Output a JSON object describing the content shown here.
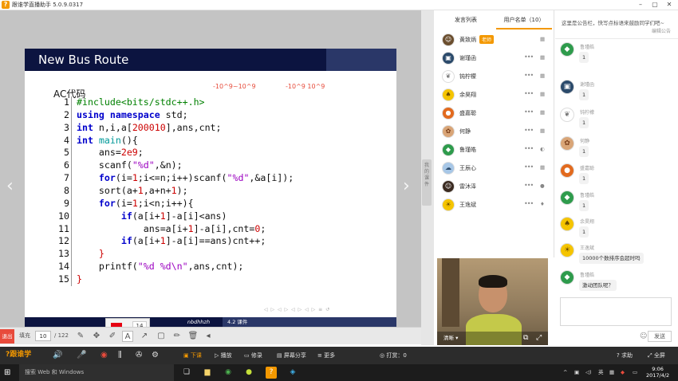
{
  "window": {
    "title": "跟谁学直播助手 5.0.9.0317",
    "logo": "?",
    "min": "–",
    "max": "▢",
    "close": "✕"
  },
  "slide": {
    "title": "New Bus Route",
    "ac_label": "AC代码",
    "note_left": "-10^9~10^9",
    "note_right": "-10^9 10^9",
    "footer_mid": "nbdhhzh",
    "footer_right": "4.2 课件",
    "beamer_nav": "◁ ▷ ◁ ▷ ◁ ▷ ◁ ▷ ≡ ↺"
  },
  "code_lines": [
    "1",
    "2",
    "3",
    "4",
    "5",
    "6",
    "7",
    "8",
    "9",
    "10",
    "11",
    "12",
    "13",
    "14",
    "15"
  ],
  "color_picker": {
    "font_size": "14"
  },
  "toolbar": {
    "exit": "退出",
    "fill": "填充",
    "page": "10",
    "total": "/ 122"
  },
  "strip_tab": "我 的 课 件",
  "users_panel": {
    "tab_chat": "发言列表",
    "tab_users": "用户名单（10）",
    "teacher_badge": "老师",
    "users": [
      {
        "name": "黄致炳",
        "dev": "▦"
      },
      {
        "name": "谢瑾函",
        "dev": "▦"
      },
      {
        "name": "钝柠檬",
        "dev": "▦"
      },
      {
        "name": "余昊翔",
        "dev": "▦"
      },
      {
        "name": "盛嘉聪",
        "dev": "▦"
      },
      {
        "name": "何静",
        "dev": "▦"
      },
      {
        "name": "鲁瑾皓",
        "dev": "◐"
      },
      {
        "name": "王辰心",
        "dev": "▦"
      },
      {
        "name": "雷沐泽",
        "dev": ""
      },
      {
        "name": "王逸斌",
        "dev": "♦"
      }
    ]
  },
  "video": {
    "label": "清晰 ▾"
  },
  "chat": {
    "notice": "这里是公告栏，快写点标语来鼓励同学们吧~",
    "notice_btn": "编辑公告",
    "send": "发送",
    "messages": [
      {
        "name": "鲁瑾皓",
        "text": "1"
      },
      {
        "name": "谢瑾函",
        "text": "1"
      },
      {
        "name": "钝柠檬",
        "text": "1"
      },
      {
        "name": "何静",
        "text": "1"
      },
      {
        "name": "盛嘉聪",
        "text": "1"
      },
      {
        "name": "鲁瑾皓",
        "text": "1"
      },
      {
        "name": "余昊翔",
        "text": "1"
      },
      {
        "name": "王逸斌",
        "text": "10000个数排序会超时吗"
      },
      {
        "name": "鲁瑾皓",
        "text": "激动团队呢？"
      }
    ]
  },
  "bottombar": {
    "logo": "?跟谁学",
    "class": "下课",
    "play": "播放",
    "record": "修录",
    "share": "屏幕分享",
    "more": "更多",
    "sign": "打赏：0",
    "help": "求助",
    "fullscreen": "全屏"
  },
  "taskbar": {
    "search": "搜索 Web 和 Windows",
    "ime": "英",
    "time": "9:06",
    "date": "2017/4/2"
  }
}
